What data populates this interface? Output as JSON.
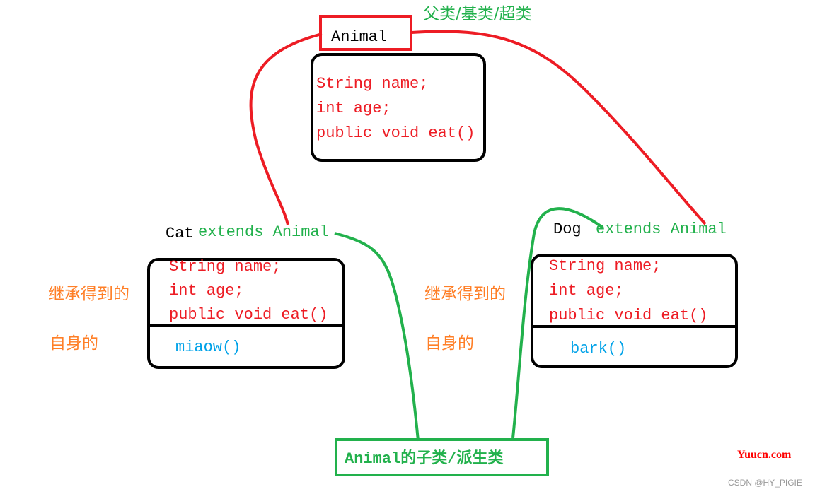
{
  "colors": {
    "red": "#ed1c24",
    "green": "#22b14c",
    "orange": "#ff7f27",
    "blue": "#00a2e8",
    "black": "#000000",
    "watermark_red": "#ff0000",
    "watermark_gray": "#999999"
  },
  "parent": {
    "class_name": "Animal",
    "annotation": "父类/基类/超类",
    "members": [
      "String name;",
      "int age;",
      "public void eat()"
    ]
  },
  "cat": {
    "class_name": "Cat",
    "extends_text": "extends Animal",
    "inherited_members": [
      "String name;",
      "int age;",
      "public void eat()"
    ],
    "own_members": [
      "miaow()"
    ],
    "inherited_label": "继承得到的",
    "own_label": "自身的"
  },
  "dog": {
    "class_name": "Dog",
    "extends_text": "extends Animal",
    "inherited_members": [
      "String name;",
      "int age;",
      "public void eat()"
    ],
    "own_members": [
      "bark()"
    ],
    "inherited_label": "继承得到的",
    "own_label": "自身的"
  },
  "subclass_label": "Animal的子类/派生类",
  "watermarks": {
    "site": "Yuucn.com",
    "author": "CSDN @HY_PIGIE"
  }
}
